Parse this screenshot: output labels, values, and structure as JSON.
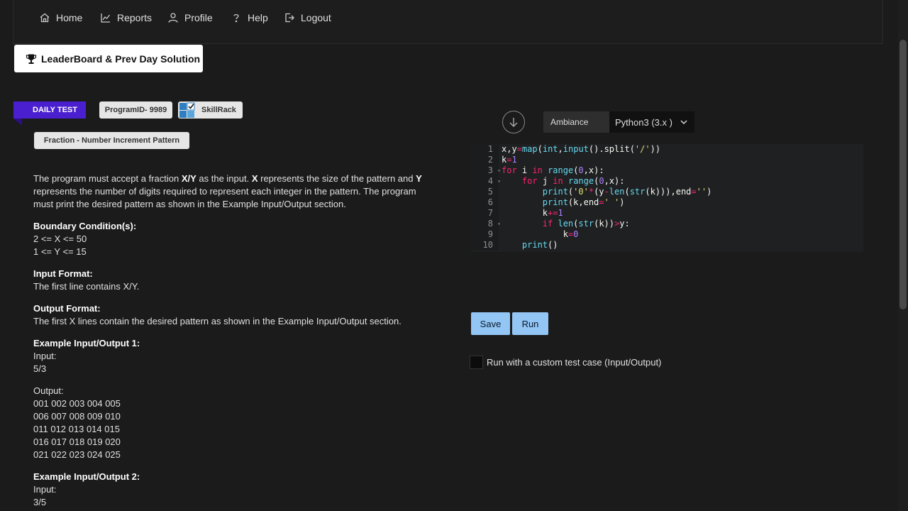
{
  "nav": {
    "items": [
      {
        "label": "Home",
        "icon": "home-icon"
      },
      {
        "label": "Reports",
        "icon": "chart-icon"
      },
      {
        "label": "Profile",
        "icon": "user-icon"
      },
      {
        "label": "Help",
        "icon": "question-icon"
      },
      {
        "label": "Logout",
        "icon": "logout-icon"
      }
    ]
  },
  "leaderboard": {
    "label": "LeaderBoard & Prev Day Solution",
    "icon": "trophy-icon"
  },
  "tags": {
    "daily": "DAILY TEST",
    "program_id": "ProgramID- 9989",
    "brand": "SkillRack"
  },
  "problem": {
    "title": "Fraction - Number Increment Pattern",
    "desc": {
      "s1": "The program must accept a fraction ",
      "b1": "X/Y",
      "s2": " as the input. ",
      "b2": "X",
      "s3": " represents the size of the pattern and ",
      "b3": "Y",
      "s4": " represents the number of digits required to represent each integer in the pattern. The program must print the desired pattern as shown in the Example Input/Output section."
    },
    "boundary": {
      "heading": "Boundary Condition(s):",
      "lines": [
        "2 <= X <= 50",
        "1 <= Y <= 15"
      ]
    },
    "input_format": {
      "heading": "Input Format:",
      "text": "The first line contains X/Y."
    },
    "output_format": {
      "heading": "Output Format:",
      "text": "The first X lines contain the desired pattern as shown in the Example Input/Output section."
    },
    "example1": {
      "heading": "Example Input/Output 1:",
      "input_label": "Input:",
      "input": "5/3",
      "output_label": "Output:",
      "output": [
        "001 002 003 004 005",
        "006 007 008 009 010",
        "011 012 013 014 015",
        "016 017 018 019 020",
        "021 022 023 024 025"
      ]
    },
    "example2": {
      "heading": "Example Input/Output 2:",
      "input_label": "Input:",
      "input": "3/5"
    }
  },
  "editor": {
    "theme": "Ambiance",
    "language": "Python3 (3.x )",
    "line_numbers": [
      "1",
      "2",
      "3",
      "4",
      "5",
      "6",
      "7",
      "8",
      "9",
      "10"
    ],
    "code": [
      "x,y=map(int,input().split('/'))",
      "k=1",
      "for i in range(0,x):",
      "    for j in range(0,x):",
      "        print('0'*(y-len(str(k))),end='')",
      "        print(k,end=' ')",
      "        k+=1",
      "        if len(str(k))>y:",
      "            k=0",
      "    print()"
    ]
  },
  "actions": {
    "save": "Save",
    "run": "Run",
    "custom_case": "Run with a custom test case (Input/Output)"
  }
}
